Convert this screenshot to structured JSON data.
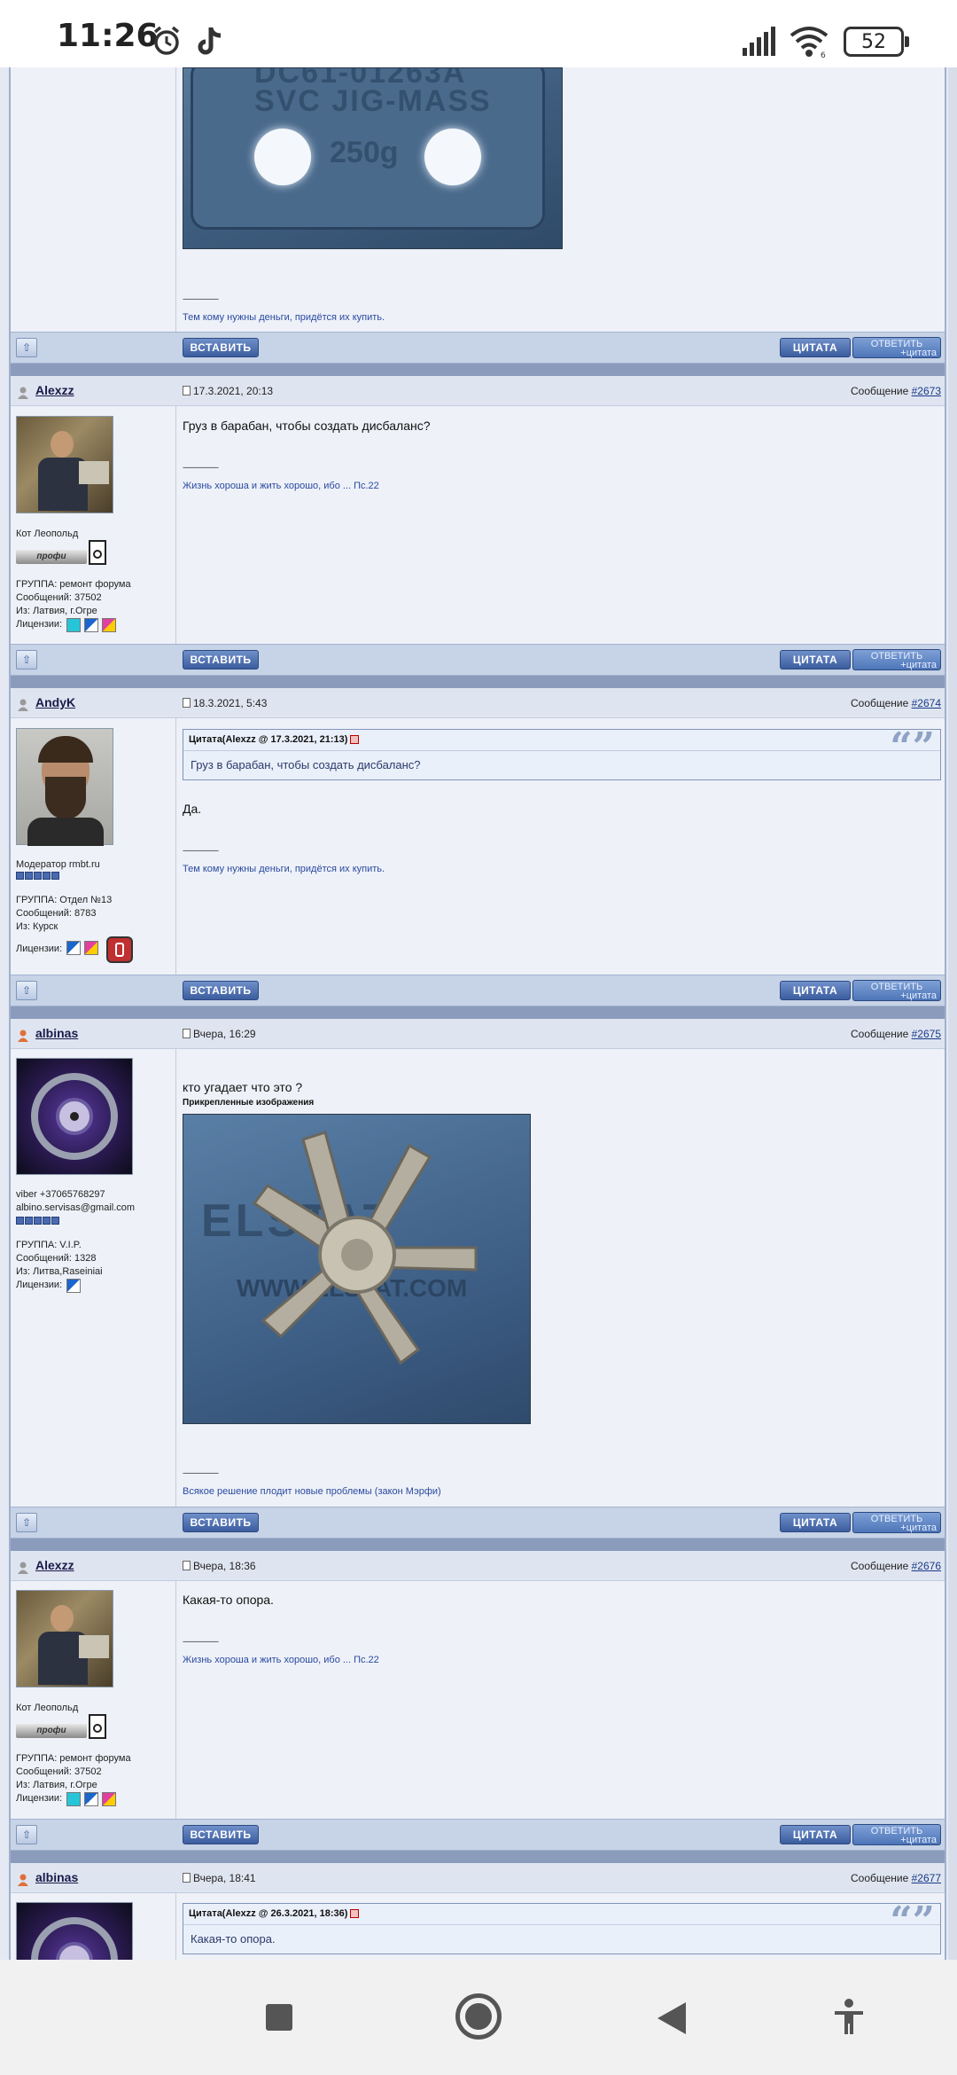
{
  "status_bar": {
    "time": "11:26",
    "battery": "52"
  },
  "buttons": {
    "insert": "ВСТАВИТЬ",
    "quote": "ЦИТАТА",
    "reply_line1": "ОТВЕТИТЬ",
    "reply_line2": "+цитата"
  },
  "top_post": {
    "image_text_line1": "DC61-01263A",
    "image_text_line2": "SVC JIG-MASS",
    "image_text_line3": "250g",
    "dashes": "--------------------",
    "signature": "Тем кому нужны деньги, придётся их купить."
  },
  "posts": [
    {
      "username": "Alexzz",
      "date": "17.3.2021, 20:13",
      "msg_label": "Сообщение ",
      "msg_num": "#2673",
      "text": "Груз в барабан, чтобы создать дисбаланс?",
      "dashes": "--------------------",
      "signature": "Жизнь хороша и жить хорошо, ибо ... Пс.22",
      "title": "Кот Леопольд",
      "rank_label": "профи",
      "group": "ГРУППА: ремонт форума",
      "messages": "Сообщений: 37502",
      "from": "Из: Латвия, г.Огре",
      "licenses": "Лицензии:"
    },
    {
      "username": "AndyK",
      "date": "18.3.2021, 5:43",
      "msg_label": "Сообщение ",
      "msg_num": "#2674",
      "quote_head": "Цитата(Alexzz @ 17.3.2021, 21:13)",
      "quote_text": "Груз в барабан, чтобы создать дисбаланс?",
      "text": "Да.",
      "dashes": "--------------------",
      "signature": "Тем кому нужны деньги, придётся их купить.",
      "title": "Модератор rmbt.ru",
      "group": "ГРУППА: Отдел №13",
      "messages": "Сообщений: 8783",
      "from": "Из: Курск",
      "licenses": "Лицензии:"
    },
    {
      "username": "albinas",
      "date": "Вчера, 16:29",
      "msg_label": "Сообщение ",
      "msg_num": "#2675",
      "text": "кто угадает что это ?",
      "attached_label": "Прикрепленные изображения",
      "image_text_line1": "ELSTAT",
      "image_text_line2": "WWW.ELSTAT.COM",
      "dashes": "--------------------",
      "signature": "Всякое решение плодит новые проблемы (закон Мэрфи)",
      "title": "viber +37065768297",
      "email": "albino.servisas@gmail.com",
      "group": "ГРУППА: V.I.P.",
      "messages": "Сообщений: 1328",
      "from": "Из: Литва,Raseiniai",
      "licenses": "Лицензии:"
    },
    {
      "username": "Alexzz",
      "date": "Вчера, 18:36",
      "msg_label": "Сообщение ",
      "msg_num": "#2676",
      "text": "Какая-то опора.",
      "dashes": "--------------------",
      "signature": "Жизнь хороша и жить хорошо, ибо ... Пс.22",
      "title": "Кот Леопольд",
      "rank_label": "профи",
      "group": "ГРУППА: ремонт форума",
      "messages": "Сообщений: 37502",
      "from": "Из: Латвия, г.Огре",
      "licenses": "Лицензии:"
    },
    {
      "username": "albinas",
      "date": "Вчера, 18:41",
      "msg_label": "Сообщение ",
      "msg_num": "#2677",
      "quote_head": "Цитата(Alexzz @ 26.3.2021, 18:36)",
      "quote_text": "Какая-то опора."
    }
  ]
}
